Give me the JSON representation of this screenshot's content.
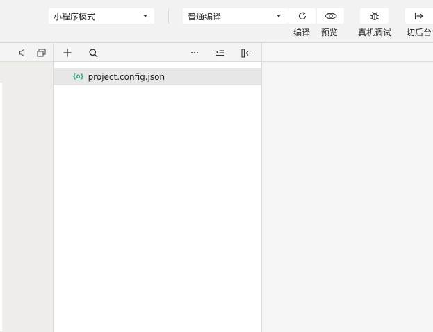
{
  "toolbar": {
    "mode_select": "小程序模式",
    "compile_select": "普通编译",
    "buttons": {
      "compile": {
        "label": "编译",
        "icon": "refresh-icon"
      },
      "preview": {
        "label": "预览",
        "icon": "eye-icon"
      },
      "debug": {
        "label": "真机调试",
        "icon": "bug-icon"
      },
      "background": {
        "label": "切后台",
        "icon": "exit-arrow-icon"
      }
    }
  },
  "left_strip": {
    "icons": [
      "mute-icon",
      "window-icon"
    ]
  },
  "explorer": {
    "toolbar_icons": [
      "add-icon",
      "search-icon",
      "more-icon",
      "collapse-icon",
      "dock-icon"
    ],
    "files": [
      {
        "icon_glyph": "{o}",
        "name": "project.config.json",
        "selected": true
      }
    ]
  },
  "colors": {
    "toolbar_bg": "#f2f2f2",
    "json_icon": "#27a36b",
    "selected_row": "#e6e7e6",
    "left_strip_bg": "#eeedea"
  }
}
